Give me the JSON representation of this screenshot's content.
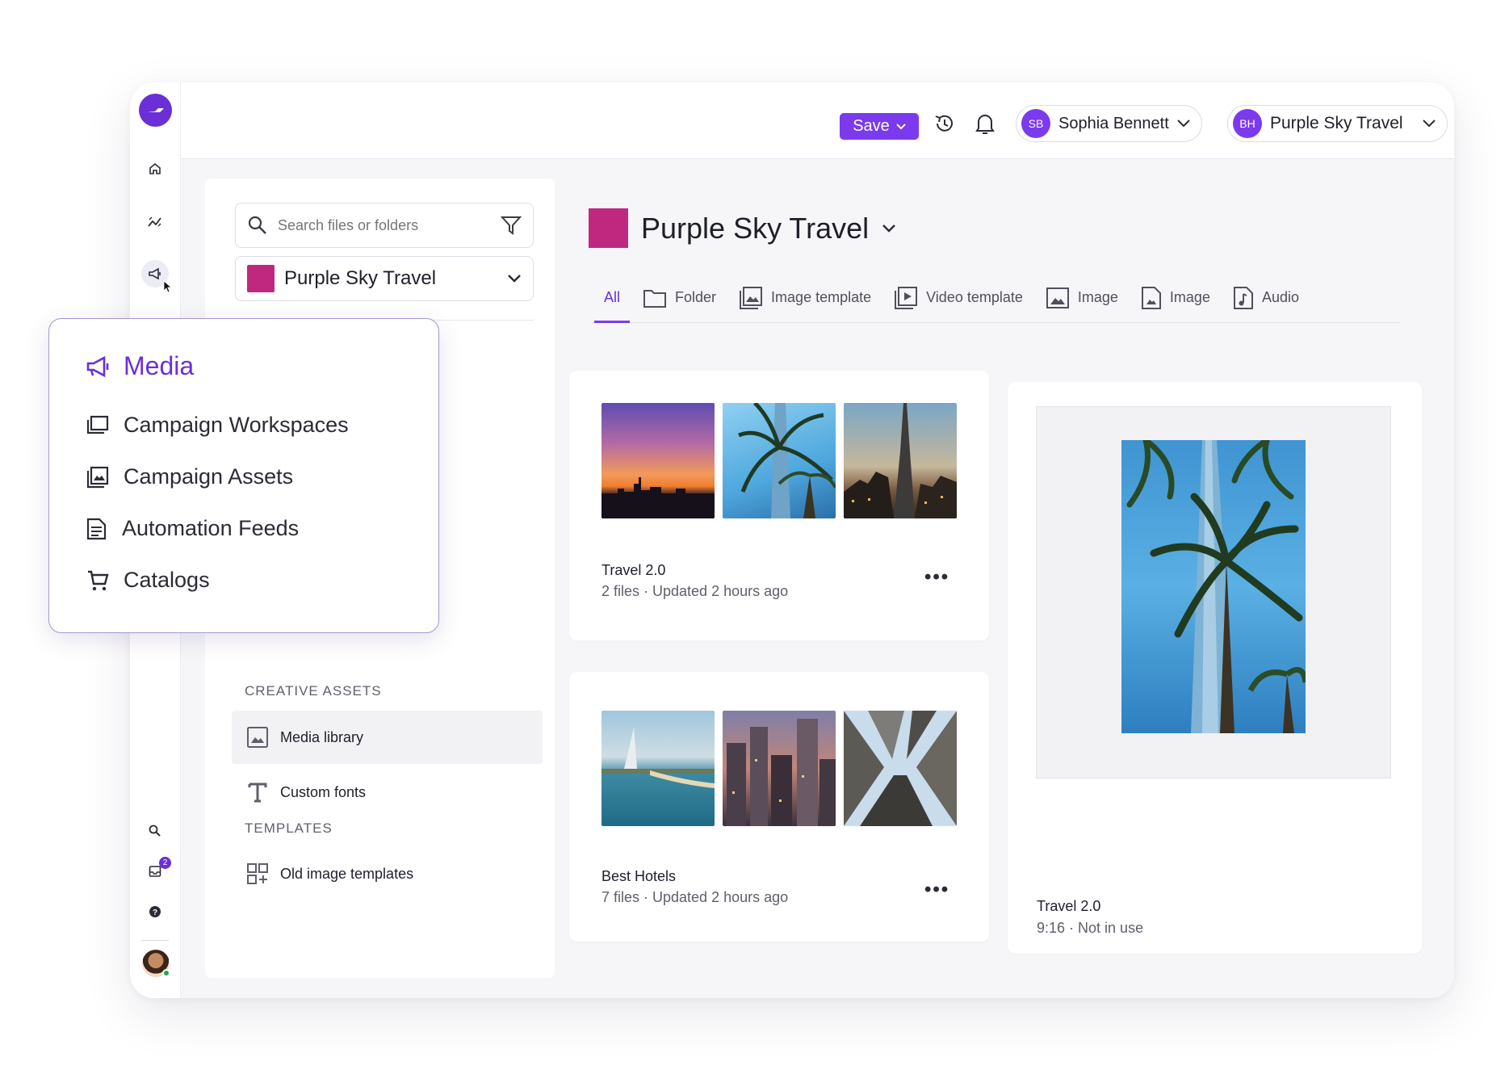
{
  "topbar": {
    "save_label": "Save",
    "user": {
      "initials": "SB",
      "name": "Sophia Bennett"
    },
    "brand": {
      "initials": "BH",
      "name": "Purple Sky Travel"
    }
  },
  "rail": {
    "notification_count": "2"
  },
  "panel": {
    "search_placeholder": "Search files or folders",
    "brand_select": "Purple Sky Travel",
    "creative_assets_label": "CREATIVE ASSETS",
    "media_library": "Media library",
    "custom_fonts": "Custom fonts",
    "templates_label": "TEMPLATES",
    "old_templates": "Old image templates"
  },
  "popover": {
    "title": "Media",
    "items": [
      {
        "label": "Campaign Workspaces"
      },
      {
        "label": "Campaign Assets"
      },
      {
        "label": "Automation Feeds"
      },
      {
        "label": "Catalogs"
      }
    ]
  },
  "main": {
    "title": "Purple Sky Travel",
    "tabs": [
      {
        "label": "All"
      },
      {
        "label": "Folder"
      },
      {
        "label": "Image template"
      },
      {
        "label": "Video template"
      },
      {
        "label": "Image"
      },
      {
        "label": "Image"
      },
      {
        "label": "Audio"
      }
    ],
    "folders": [
      {
        "title": "Travel 2.0",
        "subtitle": "2 files · Updated 2 hours ago"
      },
      {
        "title": "Best Hotels",
        "subtitle": "7 files · Updated 2 hours ago"
      }
    ],
    "preview": {
      "title": "Travel 2.0",
      "subtitle": "9:16 · Not in use"
    }
  },
  "colors": {
    "accent": "#7c3aed",
    "brand_swatch": "#c0287f"
  }
}
